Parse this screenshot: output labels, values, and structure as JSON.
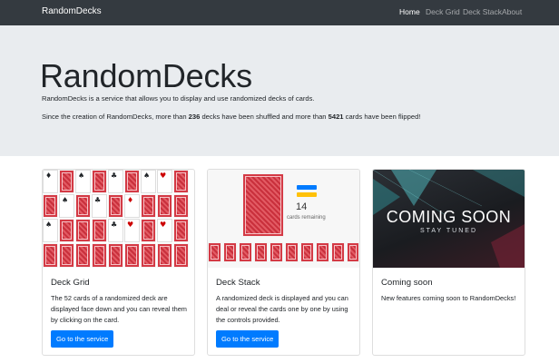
{
  "navbar": {
    "brand": "RandomDecks",
    "links": [
      {
        "label": "Home",
        "active": true
      },
      {
        "label": "Deck Grid",
        "active": false
      },
      {
        "label": "Deck Stack",
        "active": false
      },
      {
        "label": "About",
        "active": false
      }
    ]
  },
  "hero": {
    "title": "RandomDecks",
    "lead": "RandomDecks is a service that allows you to display and use randomized decks of cards.",
    "stats": {
      "prefix": "Since the creation of RandomDecks, more than ",
      "decks": "236",
      "middle": " decks have been shuffled and more than ",
      "cards": "5421",
      "suffix": " cards have been flipped!"
    }
  },
  "cards": [
    {
      "title": "Deck Grid",
      "text": "The 52 cards of a randomized deck are displayed face down and you can reveal them by clicking on the card.",
      "button": "Go to the service"
    },
    {
      "title": "Deck Stack",
      "text": "A randomized deck is displayed and you can deal or reveal the cards one by one by using the controls provided.",
      "button": "Go to the service",
      "preview": {
        "count": "14",
        "label": "cards remaining"
      }
    },
    {
      "title": "Coming soon",
      "text": "New features coming soon to RandomDecks!",
      "preview": {
        "headline": "COMING SOON",
        "sub": "STAY TUNED"
      }
    }
  ],
  "colors": {
    "navbar": "#343a40",
    "jumbotron": "#e9ecef",
    "primary": "#007bff"
  }
}
